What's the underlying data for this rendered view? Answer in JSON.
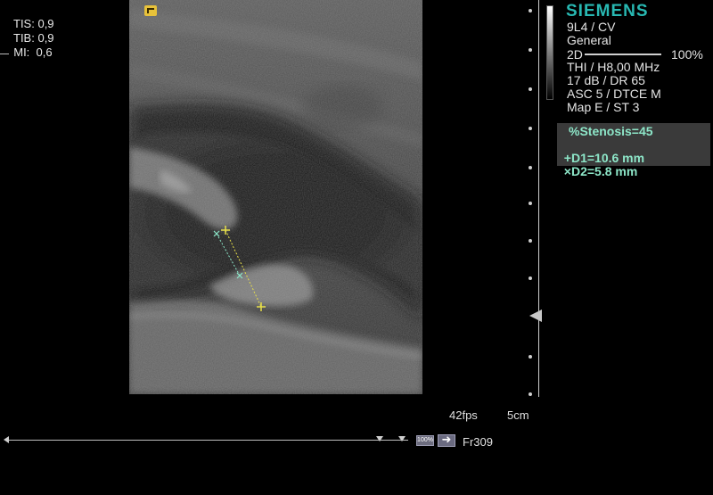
{
  "safety_indices": [
    {
      "label": "TIS:",
      "value": "0,9"
    },
    {
      "label": "TIB:",
      "value": "0,9"
    },
    {
      "label": "MI:",
      "value": "0,6"
    }
  ],
  "device": {
    "brand": "SIEMENS",
    "transducer": "9L4 / CV",
    "preset": "General",
    "mode": "2D",
    "power": "100%",
    "power_fraction": 1.0
  },
  "imaging_params": [
    "THI / H8,00 MHz",
    "17 dB / DR 65",
    "ASC 5 / DTCE M",
    "Map E / ST 3"
  ],
  "measurements": {
    "stenosis": "%Stenosis=45",
    "d1": "D1=10.6 mm",
    "d2": "D2=5.8 mm",
    "d1_marker": "+",
    "d2_marker": "×",
    "d1_color": "#e8e04a",
    "d2_color": "#8de6c8"
  },
  "status": {
    "frame_rate": "42fps",
    "depth": "5cm",
    "zoom": "100%",
    "frame": "Fr309"
  },
  "colors": {
    "brand": "#28b8b2",
    "measurement_text": "#8de6c8",
    "caliper_yellow": "#e8e04a",
    "orientation_marker": "#e8c23a"
  },
  "icons": {
    "orientation": "orientation-marker-icon",
    "focus": "focus-marker-icon",
    "cine_forward": "arrow-right-icon"
  }
}
